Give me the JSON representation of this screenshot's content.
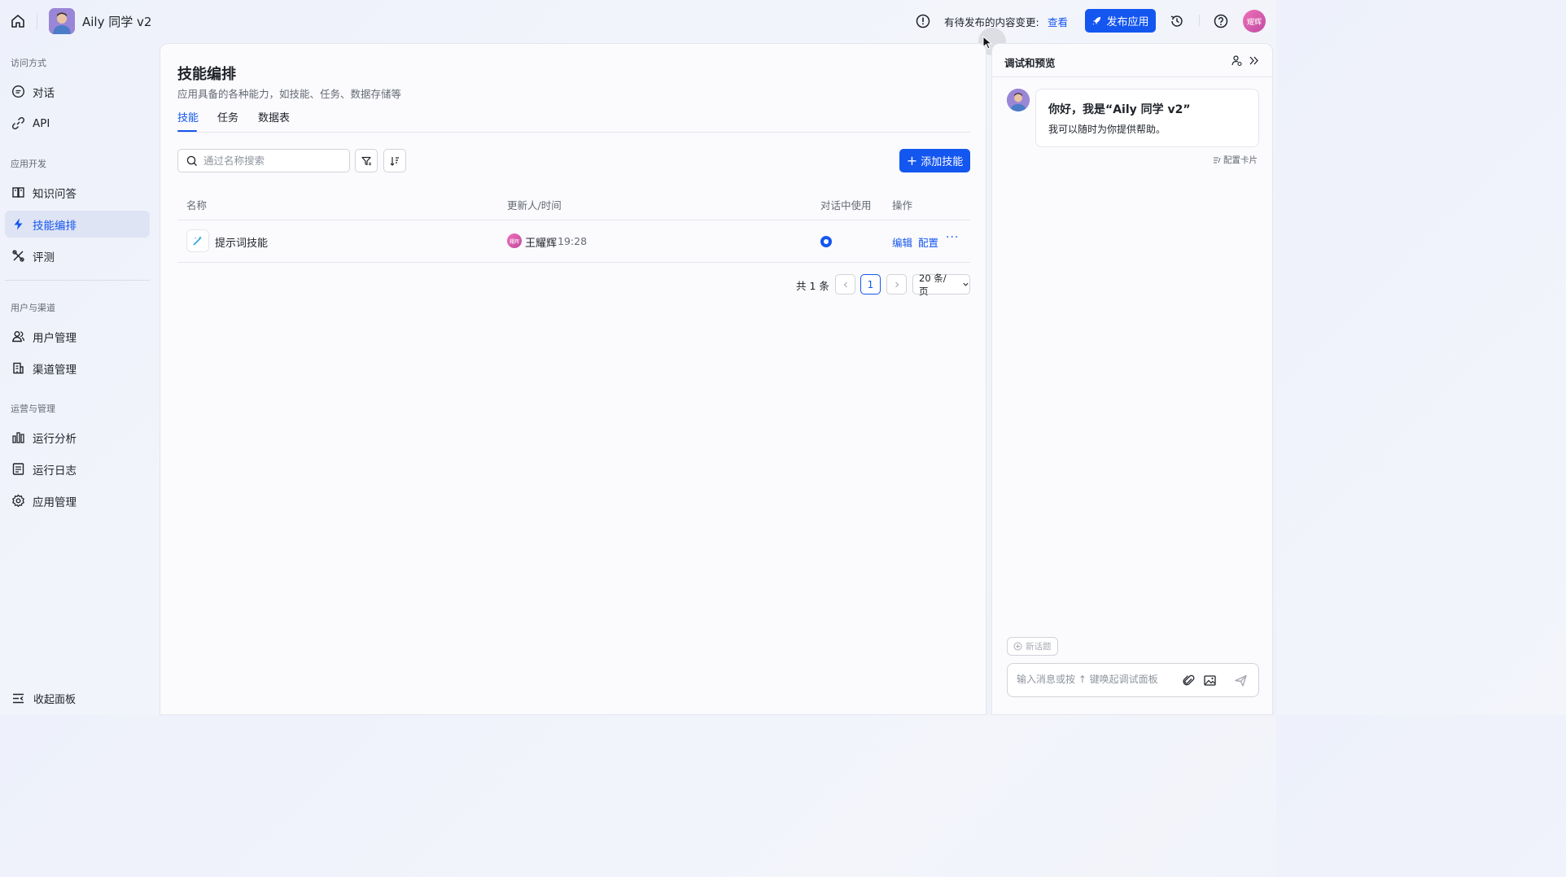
{
  "topbar": {
    "app_name": "Aily 同学 v2",
    "pending_text": "有待发布的内容变更:",
    "view_link": "查看",
    "publish_label": "发布应用",
    "user_initials": "耀辉"
  },
  "sidebar": {
    "sections": [
      {
        "title": "访问方式",
        "items": [
          {
            "label": "对话",
            "icon": "chat-icon"
          },
          {
            "label": "API",
            "icon": "link-icon"
          }
        ]
      },
      {
        "title": "应用开发",
        "items": [
          {
            "label": "知识问答",
            "icon": "book-icon"
          },
          {
            "label": "技能编排",
            "icon": "bolt-icon",
            "active": true
          },
          {
            "label": "评测",
            "icon": "evaluate-icon"
          }
        ]
      },
      {
        "title": "用户与渠道",
        "items": [
          {
            "label": "用户管理",
            "icon": "users-icon"
          },
          {
            "label": "渠道管理",
            "icon": "building-icon"
          }
        ]
      },
      {
        "title": "运营与管理",
        "items": [
          {
            "label": "运行分析",
            "icon": "bar-chart-icon"
          },
          {
            "label": "运行日志",
            "icon": "log-icon"
          },
          {
            "label": "应用管理",
            "icon": "gear-icon"
          }
        ]
      }
    ],
    "collapse_label": "收起面板"
  },
  "main": {
    "title": "技能编排",
    "subtitle": "应用具备的各种能力，如技能、任务、数据存储等",
    "tabs": [
      {
        "label": "技能",
        "active": true
      },
      {
        "label": "任务"
      },
      {
        "label": "数据表"
      }
    ],
    "search_placeholder": "通过名称搜索",
    "add_button": "添加技能",
    "table": {
      "columns": [
        "名称",
        "更新人/时间",
        "对话中使用",
        "操作"
      ],
      "rows": [
        {
          "name": "提示词技能",
          "avatar": "耀辉",
          "user": "王耀辉",
          "time": "19:28",
          "in_chat": true,
          "actions": [
            "编辑",
            "配置"
          ],
          "more": "···"
        }
      ]
    },
    "pagination": {
      "total": "共 1 条",
      "current_page": "1",
      "page_size": "20 条/页"
    }
  },
  "preview": {
    "title": "调试和预览",
    "greeting_title": "你好，我是“Aily 同学 v2”",
    "greeting_text": "我可以随时为你提供帮助。",
    "config_card": "配置卡片",
    "new_topic": "新话题",
    "input_placeholder": "输入消息或按 ↑ 键唤起调试面板"
  },
  "colors": {
    "accent": "#1456f0",
    "text": "#1f2329",
    "muted": "#646a73"
  }
}
